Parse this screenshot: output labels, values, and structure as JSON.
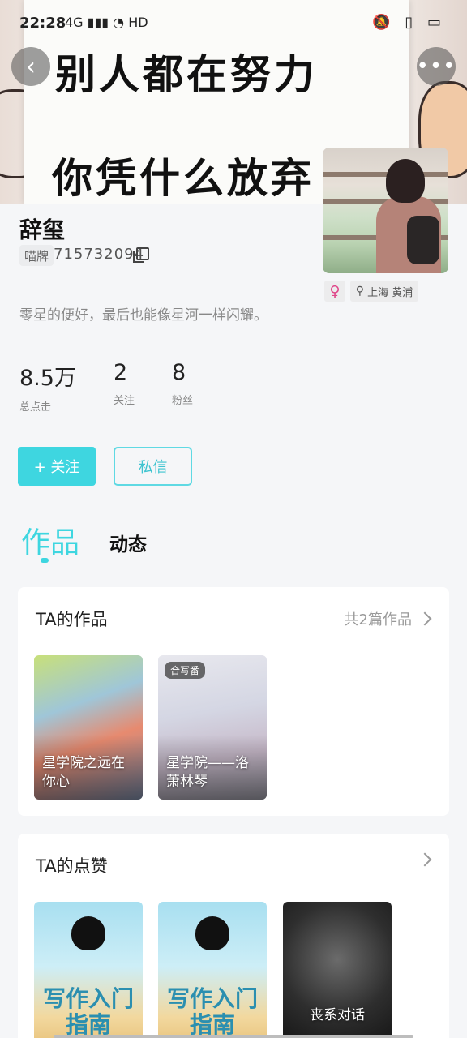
{
  "status_bar": {
    "time": "22:28",
    "signal": "4G ᵢₗₗ",
    "wifi": "HD",
    "right_icons": "🔕 ▯ ▭"
  },
  "cover": {
    "line1": "别人都在努力",
    "line2": "你凭什么放弃"
  },
  "profile": {
    "name": "辞玺",
    "id_label": "喵牌",
    "id_number": "715732094",
    "gender_symbol": "♀",
    "location": "上海 黄浦",
    "bio": "零星的便好，最后也能像星河一样闪耀。"
  },
  "stats": [
    {
      "value": "8.5万",
      "label": "总点击"
    },
    {
      "value": "2",
      "label": "关注"
    },
    {
      "value": "8",
      "label": "粉丝"
    }
  ],
  "actions": {
    "follow": "+ 关注",
    "message": "私信"
  },
  "tabs": {
    "works": "作品",
    "dynamics": "动态"
  },
  "works_section": {
    "title": "TA的作品",
    "count_text": "共2篇作品",
    "items": [
      {
        "title": "星学院之远在你心",
        "badge": ""
      },
      {
        "title": "星学院——洛萧林琴",
        "badge": "合写番"
      }
    ]
  },
  "likes_section": {
    "title": "TA的点赞",
    "items": [
      {
        "cover_text": "写作入门指南",
        "title": ""
      },
      {
        "cover_text": "写作入门指南",
        "title": ""
      },
      {
        "cover_text": "",
        "title": "丧系对话"
      }
    ]
  }
}
